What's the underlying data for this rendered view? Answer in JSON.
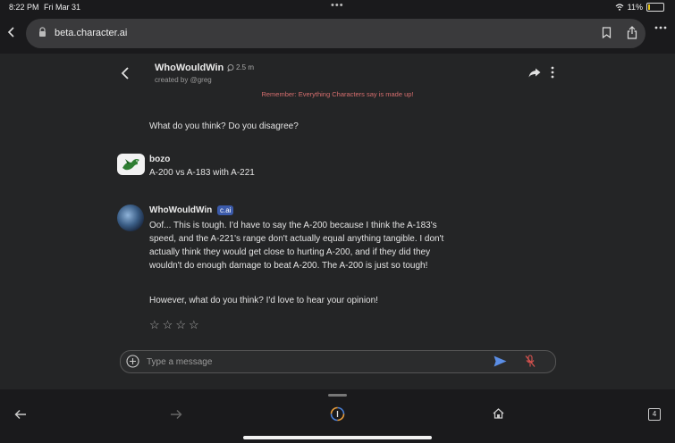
{
  "status": {
    "time": "8:22 PM",
    "date": "Fri Mar 31",
    "battery": "11%",
    "battery_level": 0.11
  },
  "browser": {
    "url": "beta.character.ai"
  },
  "header": {
    "title": "WhoWouldWin",
    "count": "2.5 m",
    "creator": "created by @greg",
    "remember": "Remember: Everything Characters say is made up!"
  },
  "messages": {
    "prev_text": "What do you think? Do you disagree?",
    "user": {
      "name": "bozo",
      "text": "A-200 vs A-183 with A-221"
    },
    "bot": {
      "name": "WhoWouldWin",
      "badge": "c.ai",
      "line1": "Oof... This is tough. I'd have to say the A-200 because I think the A-183's",
      "line2": "speed, and the A-221's range don't actually equal anything tangible. I don't",
      "line3": "actually think they would get close to hurting A-200, and if they did they",
      "line4": "wouldn't do enough damage to beat A-200. The A-200 is just so tough!",
      "line5": "However, what do you think? I'd love to hear your opinion!"
    },
    "stars": [
      "☆",
      "☆",
      "☆",
      "☆"
    ]
  },
  "input": {
    "placeholder": "Type a message"
  },
  "toolbar": {
    "tab_count": "4"
  },
  "colors": {
    "accent": "#3b5aa9",
    "warning": "#d66e6e",
    "send": "#5b8ee6",
    "mic_muted": "#d9534f"
  }
}
